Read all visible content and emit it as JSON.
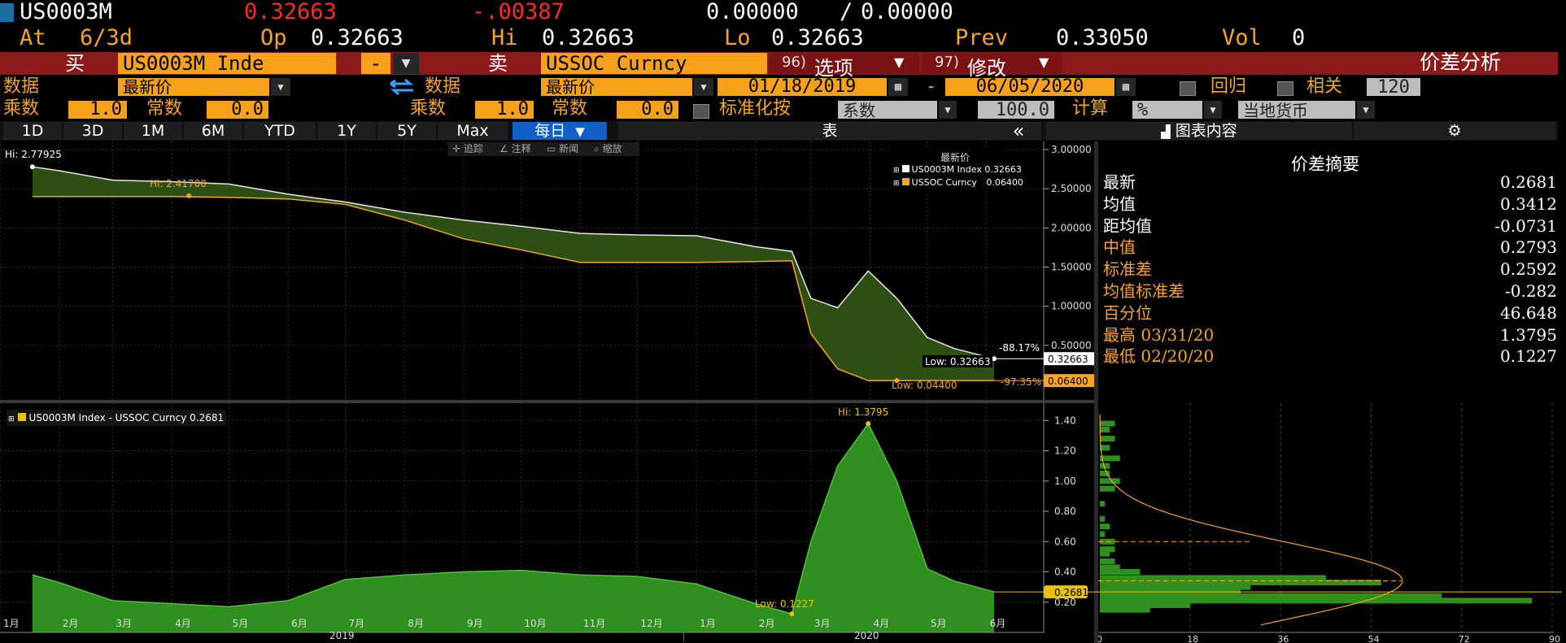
{
  "quote": {
    "ticker": "US0003M",
    "last": "0.32663",
    "change": "-.00387",
    "bid": "0.00000",
    "ask": "0.00000",
    "at_label": "At",
    "at_value": "6/3d",
    "op_label": "Op",
    "op_value": "0.32663",
    "hi_label": "Hi",
    "hi_value": "0.32663",
    "lo_label": "Lo",
    "lo_value": "0.32663",
    "prev_label": "Prev",
    "prev_value": "0.33050",
    "vol_label": "Vol",
    "vol_value": "0"
  },
  "toolbar": {
    "buy_label": "买",
    "buy_security": "US0003M Inde",
    "minus_label": "-",
    "sell_label": "卖",
    "sell_security": "USSOC Curncy",
    "options_num": "96)",
    "options_label": "选项",
    "modify_num": "97)",
    "modify_label": "修改",
    "title": "价差分析"
  },
  "row2": {
    "data_label1": "数据",
    "data_value1": "最新价",
    "data_label2": "数据",
    "data_value2": "最新价",
    "date_from": "01/18/2019",
    "date_sep": "-",
    "date_to": "06/05/2020",
    "regress_label": "回归",
    "corr_label": "相关",
    "corr_value": "120"
  },
  "row3": {
    "mult_label1": "乘数",
    "mult_value1": "1.0",
    "const_label1": "常数",
    "const_value1": "0.0",
    "mult_label2": "乘数",
    "mult_value2": "1.0",
    "const_label2": "常数",
    "const_value2": "0.0",
    "normalize_label": "标准化按",
    "normalize_value": "系数",
    "normalize_num": "100.0",
    "calc_label": "计算",
    "calc_value": "%",
    "currency_value": "当地货币"
  },
  "tabs": {
    "periods": [
      "1D",
      "3D",
      "1M",
      "6M",
      "YTD",
      "1Y",
      "5Y",
      "Max"
    ],
    "freq": "每日",
    "table": "表",
    "collapse": "«",
    "chart_content": "图表内容"
  },
  "chart_tools": [
    "追踪",
    "注释",
    "新闻",
    "缩放"
  ],
  "summary": {
    "title": "价差摘要",
    "rows": [
      {
        "k": "最新",
        "v": "0.2681",
        "hl": false
      },
      {
        "k": "均值",
        "v": "0.3412",
        "hl": false
      },
      {
        "k": "距均值",
        "v": "-0.0731",
        "hl": false
      },
      {
        "k": "中值",
        "v": "0.2793",
        "hl": true
      },
      {
        "k": "标准差",
        "v": "0.2592",
        "hl": true
      },
      {
        "k": "均值标准差",
        "v": "-0.282",
        "hl": true
      },
      {
        "k": "百分位",
        "v": "46.648",
        "hl": true
      },
      {
        "k": "最高 03/31/20",
        "v": "1.3795",
        "hl": true
      },
      {
        "k": "最低 02/20/20",
        "v": "0.1227",
        "hl": true
      }
    ]
  },
  "colors": {
    "amber": "#f5a623",
    "green": "#2f8f1f",
    "dark_green": "#2e4f12",
    "red_bar": "#8c1a1a",
    "select_blue": "#1060c8"
  },
  "chart_data": [
    {
      "type": "area",
      "legend_title": "最新价",
      "series": [
        {
          "name": "US0003M Index",
          "legend_value": "0.32663",
          "color": "#ffffff"
        },
        {
          "name": "USSOC Curncy",
          "legend_value": "0.06400",
          "color": "#f5a623"
        }
      ],
      "x": [
        "2019-01-18",
        "2019-02-01",
        "2019-03-01",
        "2019-04-01",
        "2019-05-01",
        "2019-06-01",
        "2019-07-01",
        "2019-08-01",
        "2019-09-01",
        "2019-10-01",
        "2019-11-01",
        "2019-12-01",
        "2020-01-01",
        "2020-02-01",
        "2020-02-20",
        "2020-03-01",
        "2020-03-15",
        "2020-03-31",
        "2020-04-15",
        "2020-05-01",
        "2020-05-15",
        "2020-06-05"
      ],
      "us0003m": [
        2.78,
        2.73,
        2.61,
        2.59,
        2.56,
        2.43,
        2.33,
        2.2,
        2.1,
        2.02,
        1.93,
        1.91,
        1.9,
        1.76,
        1.7,
        1.1,
        0.98,
        1.45,
        1.1,
        0.6,
        0.46,
        0.33
      ],
      "ussoc": [
        2.4,
        2.4,
        2.4,
        2.4,
        2.39,
        2.37,
        2.3,
        2.1,
        1.86,
        1.72,
        1.56,
        1.56,
        1.56,
        1.57,
        1.58,
        0.65,
        0.2,
        0.05,
        0.05,
        0.05,
        0.05,
        0.05
      ],
      "ylim": [
        0,
        3.0
      ],
      "y_ticks": [
        "0.50000",
        "1.00000",
        "1.50000",
        "2.00000",
        "2.50000",
        "3.00000"
      ],
      "annotations": {
        "hi_top": "Hi: 2.77925",
        "hi_orange": "Hi: 2.41700",
        "low_white": "Low: 0.32663",
        "low_orange": "Low: 0.04400",
        "pct_white": "-88.17%",
        "pct_orange": "-97.35%",
        "last_white": "0.32663",
        "last_orange": "0.06400"
      }
    },
    {
      "type": "area",
      "legend": "US0003M Index - USSOC Curncy 0.2681",
      "x": [
        "2019-01-18",
        "2019-02-01",
        "2019-03-01",
        "2019-04-01",
        "2019-05-01",
        "2019-06-01",
        "2019-07-01",
        "2019-08-01",
        "2019-09-01",
        "2019-10-01",
        "2019-11-01",
        "2019-12-01",
        "2020-01-01",
        "2020-02-01",
        "2020-02-20",
        "2020-03-01",
        "2020-03-15",
        "2020-03-31",
        "2020-04-15",
        "2020-05-01",
        "2020-05-15",
        "2020-06-05"
      ],
      "values": [
        0.38,
        0.33,
        0.21,
        0.19,
        0.17,
        0.21,
        0.35,
        0.38,
        0.4,
        0.41,
        0.38,
        0.37,
        0.32,
        0.19,
        0.1227,
        0.6,
        1.1,
        1.3795,
        1.0,
        0.42,
        0.34,
        0.2681
      ],
      "ylim": [
        0,
        1.45
      ],
      "y_ticks": [
        "0.20",
        "0.40",
        "0.60",
        "0.80",
        "1.00",
        "1.20",
        "1.40"
      ],
      "annotations": {
        "hi": "Hi: 1.3795",
        "low": "Low: 0.1227",
        "last": "0.2681"
      }
    },
    {
      "type": "bar",
      "orientation": "horizontal",
      "x_ticks": [
        "0",
        "18",
        "36",
        "54",
        "72",
        "90"
      ]
    }
  ],
  "x_axis": {
    "months": [
      "1月",
      "2月",
      "3月",
      "4月",
      "5月",
      "6月",
      "7月",
      "8月",
      "9月",
      "10月",
      "11月",
      "12月",
      "1月",
      "2月",
      "3月",
      "4月",
      "5月",
      "6月"
    ],
    "years": [
      "2019",
      "2020"
    ]
  }
}
